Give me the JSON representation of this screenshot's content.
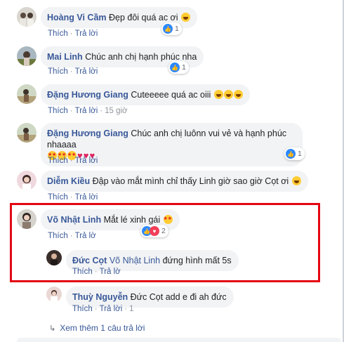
{
  "comments": [
    {
      "author": "Hoàng Vi Cầm",
      "text": "Đẹp đôi quá ac ơi",
      "emoji": "laugh",
      "like": "Thích",
      "reply": "Trả lời",
      "reactions": "1"
    },
    {
      "author": "Mai Linh",
      "text": "Chúc anh chị hạnh phúc nha",
      "like": "Thích",
      "reply": "Trả lời",
      "reactions": "1"
    },
    {
      "author": "Đặng Hương Giang",
      "text": "Cuteeeee quá ac oiii",
      "like": "Thích",
      "reply": "Trả lời",
      "time": "15 giờ"
    },
    {
      "author": "Đặng Hương Giang",
      "text": "Chúc anh chị luônn vui vẻ và hạnh phúc nhaaaa",
      "like": "Thích",
      "reply": "Trả lời",
      "reactions": "1"
    },
    {
      "author": "Diễm Kiều",
      "text": "Đập vào mắt mình chỉ thấy Linh giờ sao giờ Cọt ơi",
      "like": "Thích",
      "reply": "Trả lời"
    },
    {
      "author": "Võ Nhật Linh",
      "text": "Mắt lé xinh gái",
      "like": "Thích",
      "reply": "Trả lờ",
      "reactions": "2"
    },
    {
      "author": "Đức Cọt",
      "mention": "Võ Nhật Linh",
      "text": "đứng hình mất 5s",
      "like": "Thích",
      "reply": "Trả lờ"
    },
    {
      "author": "Thuỳ Nguyễn",
      "text": "Đức Cọt add e đi ah đức",
      "like": "Thích",
      "reply": "Trả lời",
      "time": "1"
    }
  ],
  "show_more": "Xem thêm 1 câu trả lời",
  "colors": {
    "link": "#385898",
    "bubble": "#f2f3f5",
    "highlight": "#e30613",
    "like": "#2d88ff",
    "love": "#f33e58"
  }
}
